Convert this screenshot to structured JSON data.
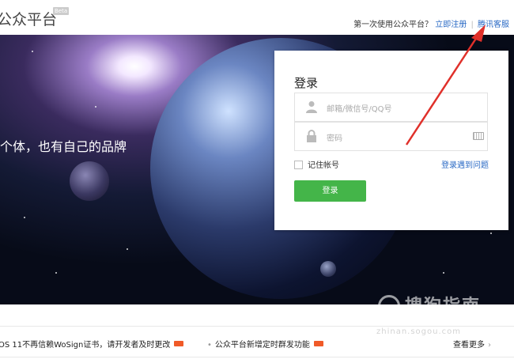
{
  "header": {
    "logo_text": "公众平台",
    "beta_label": "Beta",
    "prompt_text": "第一次使用公众平台？",
    "register_link": "立即注册",
    "separator": "|",
    "support_link": "腾讯客服"
  },
  "hero": {
    "tagline": "个体，也有自己的品牌"
  },
  "login": {
    "title": "登录",
    "account_placeholder": "邮箱/微信号/QQ号",
    "password_placeholder": "密码",
    "remember_label": "记住帐号",
    "trouble_link": "登录遇到问题",
    "submit_label": "登录"
  },
  "notices": {
    "item1": "OS 11不再信赖WoSign证书，请开发者及时更改",
    "item2": "公众平台新增定时群发功能",
    "more_label": "查看更多",
    "bullet": "•",
    "new_badge_color": "#f05a28"
  },
  "watermark": {
    "text": "搜狗指南",
    "sub": "zhinan.sogou.com"
  },
  "colors": {
    "accent_green": "#44b549",
    "link_blue": "#2a6ac5",
    "arrow_red": "#e0302a"
  }
}
